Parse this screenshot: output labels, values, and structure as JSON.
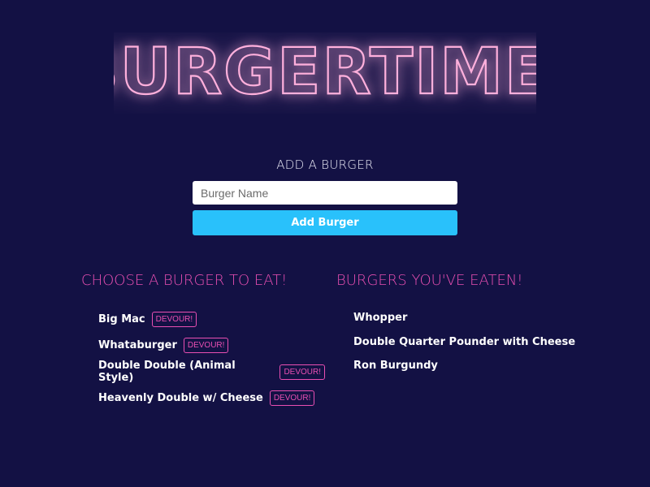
{
  "app": {
    "title": "BURGERTIME!"
  },
  "add_form": {
    "heading": "ADD A BURGER",
    "input_value": "",
    "input_placeholder": "Burger Name",
    "button_label": "Add Burger"
  },
  "uneaten": {
    "heading": "CHOOSE A BURGER TO EAT!",
    "items": [
      {
        "name": "Big Mac",
        "button": "DEVOUR!"
      },
      {
        "name": "Whataburger",
        "button": "DEVOUR!"
      },
      {
        "name": "Double Double (Animal Style)",
        "button": "DEVOUR!"
      },
      {
        "name": "Heavenly Double w/ Cheese",
        "button": "DEVOUR!"
      }
    ]
  },
  "eaten": {
    "heading": "BURGERS YOU'VE EATEN!",
    "items": [
      {
        "name": "Whopper"
      },
      {
        "name": "Double Quarter Pounder with Cheese"
      },
      {
        "name": "Ron Burgundy"
      }
    ]
  },
  "colors": {
    "background": "#131144",
    "neon_pink": "#e94fb2",
    "neon_glow": "#ff6fc4",
    "accent_blue": "#29c1fb",
    "text_white": "#ffffff"
  }
}
